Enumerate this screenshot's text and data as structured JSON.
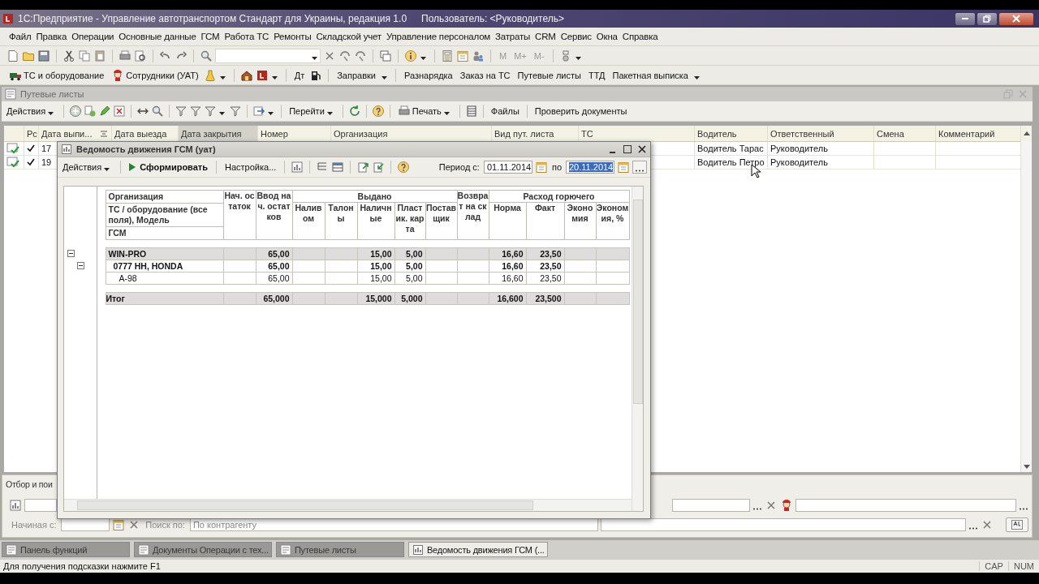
{
  "window": {
    "title": "1С:Предприятие - Управление автотранспортом Стандарт для Украины, редакция 1.0",
    "user": "Пользователь: <Руководитель>"
  },
  "menu": [
    "Файл",
    "Правка",
    "Операции",
    "Основные данные",
    "ГСМ",
    "Работа ТС",
    "Ремонты",
    "Складской учет",
    "Управление персоналом",
    "Затраты",
    "CRM",
    "Сервис",
    "Окна",
    "Справка"
  ],
  "memory_buttons": [
    "M",
    "M+",
    "M-"
  ],
  "quick_bar": [
    "ТС и оборудование",
    "Сотрудники (УАТ)",
    "Дт",
    "Заправки",
    "Разнарядка",
    "Заказ на ТС",
    "Путевые листы",
    "ТТД",
    "Пакетная выписка"
  ],
  "list_window": {
    "title": "Путевые листы",
    "toolbar": [
      "Действия",
      "Перейти",
      "Печать",
      "Файлы",
      "Проверить документы"
    ],
    "columns": [
      {
        "label": "Рс",
        "selected": false
      },
      {
        "label": "Дата выпи...",
        "selected": false
      },
      {
        "label": "Дата выезда",
        "selected": false
      },
      {
        "label": "Дата закрытия",
        "selected": true
      },
      {
        "label": "Номер",
        "selected": false
      },
      {
        "label": "Организация",
        "selected": false
      },
      {
        "label": "Вид пут. листа",
        "selected": false
      },
      {
        "label": "ТС",
        "selected": false
      },
      {
        "label": "Водитель",
        "selected": false
      },
      {
        "label": "Ответственный",
        "selected": false
      },
      {
        "label": "Смена",
        "selected": false
      },
      {
        "label": "Комментарий",
        "selected": false
      }
    ],
    "rows": [
      {
        "posted": true,
        "checked": true,
        "date": "17",
        "driver": "Водитель Тарас",
        "responsible": "Руководитель"
      },
      {
        "posted": true,
        "checked": true,
        "date": "19",
        "driver": "Водитель Петро",
        "responsible": "Руководитель"
      }
    ]
  },
  "filter_panel": {
    "title": "Отбор и пои",
    "start_label": "Начиная с:",
    "search_label": "Поиск по:",
    "search_value": "По контрагенту",
    "disabled": true
  },
  "report": {
    "title": "Ведомость движения ГСМ (уат)",
    "actions": "Действия",
    "generate": "Сформировать",
    "settings": "Настройка...",
    "period_label": "Период с:",
    "period_from": "01.11.2014",
    "period_to_label": "по",
    "period_to": "20.11.2014",
    "period_to_highlighted": true,
    "org_header": [
      "Организация",
      "ТС / оборудование (все поля), Модель",
      "ГСМ"
    ],
    "header": [
      {
        "kind": "single",
        "label": "Нач. остаток"
      },
      {
        "kind": "single",
        "label": "Ввод нач. остатков"
      },
      {
        "kind": "group",
        "label": "Выдано",
        "children": [
          "Наливом",
          "Талоны",
          "Наличные",
          "Пластик. карта",
          "Поставщик"
        ]
      },
      {
        "kind": "single",
        "label": "Возврат на склад"
      },
      {
        "kind": "group",
        "label": "Расход горючего",
        "children": [
          "Норма",
          "Факт",
          "Экономия",
          "Экономия, %"
        ]
      }
    ],
    "rows": [
      {
        "kind": "organization",
        "label": "WIN-PRO",
        "expanded": true,
        "cells": [
          null,
          "65,00",
          null,
          null,
          "15,00",
          "5,00",
          null,
          null,
          "16,60",
          "23,50",
          null,
          null
        ],
        "children": [
          {
            "kind": "vehicle",
            "label": "0777 HH, HONDA",
            "expanded": true,
            "cells": [
              null,
              "65,00",
              null,
              null,
              "15,00",
              "5,00",
              null,
              null,
              "16,60",
              "23,50",
              null,
              null
            ],
            "children": [
              {
                "kind": "fuel",
                "label": "А-98",
                "cells": [
                  null,
                  "65,00",
                  null,
                  null,
                  "15,00",
                  "5,00",
                  null,
                  null,
                  "16,60",
                  "23,50",
                  null,
                  null
                ]
              }
            ]
          }
        ]
      }
    ],
    "total": {
      "label": "Итог",
      "cells": [
        null,
        "65,000",
        null,
        null,
        "15,000",
        "5,000",
        null,
        null,
        "16,600",
        "23,500",
        null,
        null
      ]
    }
  },
  "taskbar": [
    {
      "label": "Панель функций",
      "selected": false
    },
    {
      "label": "Документы Операции с тех...",
      "selected": false
    },
    {
      "label": "Путевые листы",
      "selected": false
    },
    {
      "label": "Ведомость движения ГСМ (...",
      "selected": true
    }
  ],
  "status_bar": {
    "hint": "Для получения подсказки нажмите F1",
    "indicators": [
      "CAP",
      "NUM"
    ]
  }
}
